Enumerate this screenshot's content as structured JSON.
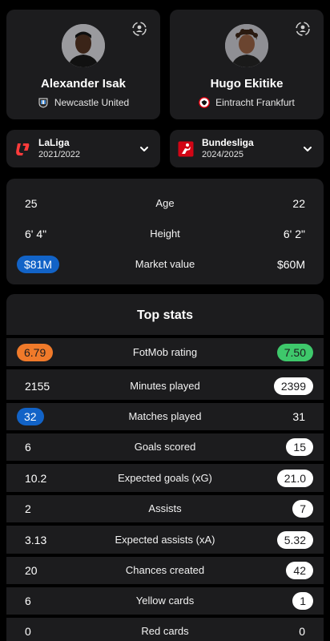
{
  "players": {
    "left": {
      "name": "Alexander Isak",
      "club": "Newcastle United"
    },
    "right": {
      "name": "Hugo Ekitike",
      "club": "Eintracht Frankfurt"
    }
  },
  "leagues": {
    "left": {
      "name": "LaLiga",
      "season": "2021/2022"
    },
    "right": {
      "name": "Bundesliga",
      "season": "2024/2025"
    }
  },
  "bio": [
    {
      "label": "Age",
      "left": "25",
      "right": "22"
    },
    {
      "label": "Height",
      "left": "6' 4\"",
      "right": "6' 2\""
    },
    {
      "label": "Market value",
      "left": "$81M",
      "right": "$60M"
    }
  ],
  "top_stats": {
    "title": "Top stats",
    "rows": [
      {
        "label": "FotMob rating",
        "left": "6.79",
        "right": "7.50"
      },
      {
        "label": "Minutes played",
        "left": "2155",
        "right": "2399"
      },
      {
        "label": "Matches played",
        "left": "32",
        "right": "31"
      },
      {
        "label": "Goals scored",
        "left": "6",
        "right": "15"
      },
      {
        "label": "Expected goals (xG)",
        "left": "10.2",
        "right": "21.0"
      },
      {
        "label": "Assists",
        "left": "2",
        "right": "7"
      },
      {
        "label": "Expected assists (xA)",
        "left": "3.13",
        "right": "5.32"
      },
      {
        "label": "Chances created",
        "left": "20",
        "right": "42"
      },
      {
        "label": "Yellow cards",
        "left": "6",
        "right": "1"
      },
      {
        "label": "Red cards",
        "left": "0",
        "right": "0"
      }
    ]
  },
  "colors": {
    "card": "#1c1c1e",
    "rating_left": "#f07a2a",
    "rating_right": "#3ec86b",
    "highlight_blue": "#1263c7",
    "highlight_white": "#ffffff"
  }
}
